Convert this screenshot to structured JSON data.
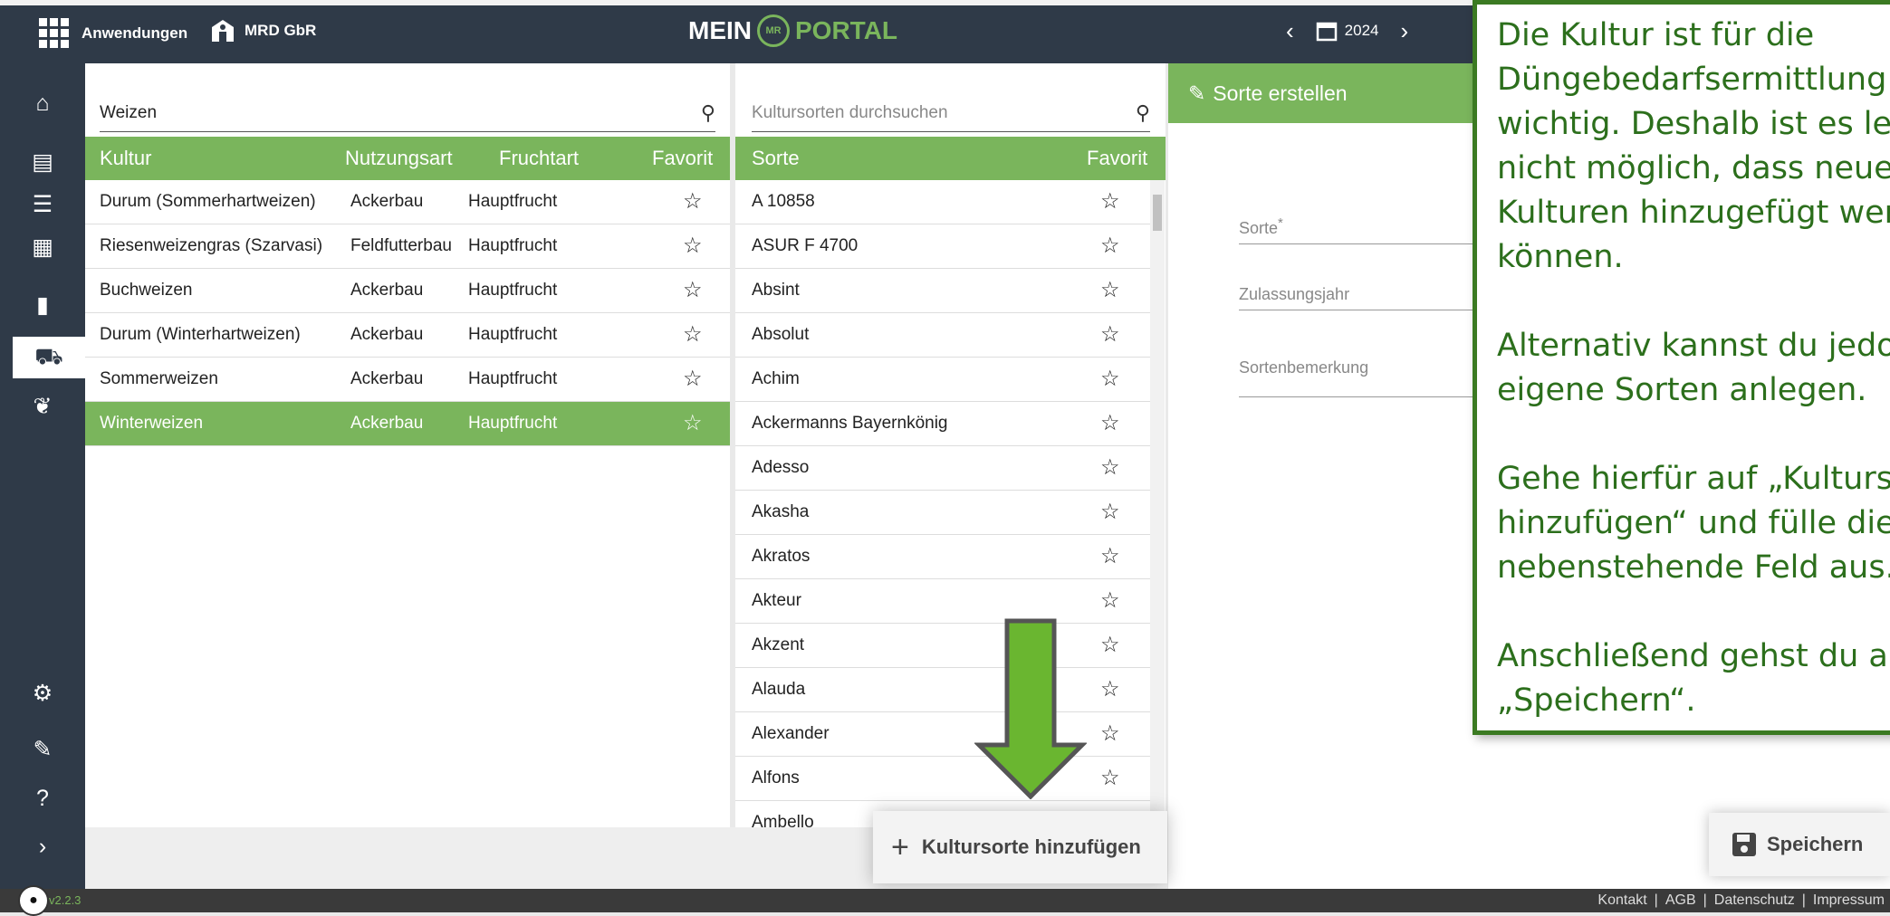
{
  "header": {
    "apps_label": "Anwendungen",
    "farm_name": "MRD GbR",
    "logo_left": "MEIN",
    "logo_seal": "MR",
    "logo_right": "PORTAL",
    "year": "2024"
  },
  "sidebar": {
    "items": [
      {
        "name": "home-icon",
        "glyph": "⌂"
      },
      {
        "name": "field-list-icon",
        "glyph": "▤"
      },
      {
        "name": "clipboard-icon",
        "glyph": "☰"
      },
      {
        "name": "calendar-icon",
        "glyph": "▦"
      },
      {
        "name": "bar-chart-icon",
        "glyph": "▮"
      },
      {
        "name": "tractor-icon",
        "glyph": "⛟"
      },
      {
        "name": "wheat-icon",
        "glyph": "❦"
      },
      {
        "name": "settings-icon",
        "glyph": "⚙"
      },
      {
        "name": "admin-icon",
        "glyph": "✎"
      },
      {
        "name": "help-icon",
        "glyph": "?"
      },
      {
        "name": "expand-icon",
        "glyph": "›"
      }
    ]
  },
  "cultures": {
    "search_value": "Weizen",
    "headers": {
      "kultur": "Kultur",
      "nutzungsart": "Nutzungsart",
      "fruchtart": "Fruchtart",
      "favorit": "Favorit"
    },
    "rows": [
      {
        "kultur": "Durum (Sommerhartweizen)",
        "nutzungsart": "Ackerbau",
        "fruchtart": "Hauptfrucht",
        "selected": false
      },
      {
        "kultur": "Riesenweizengras (Szarvasi)",
        "nutzungsart": "Feldfutterbau",
        "fruchtart": "Hauptfrucht",
        "selected": false
      },
      {
        "kultur": "Buchweizen",
        "nutzungsart": "Ackerbau",
        "fruchtart": "Hauptfrucht",
        "selected": false
      },
      {
        "kultur": "Durum (Winterhartweizen)",
        "nutzungsart": "Ackerbau",
        "fruchtart": "Hauptfrucht",
        "selected": false
      },
      {
        "kultur": "Sommerweizen",
        "nutzungsart": "Ackerbau",
        "fruchtart": "Hauptfrucht",
        "selected": false
      },
      {
        "kultur": "Winterweizen",
        "nutzungsart": "Ackerbau",
        "fruchtart": "Hauptfrucht",
        "selected": true
      }
    ]
  },
  "varieties": {
    "search_placeholder": "Kultursorten durchsuchen",
    "headers": {
      "sorte": "Sorte",
      "favorit": "Favorit"
    },
    "rows": [
      "A 10858",
      "ASUR F 4700",
      "Absint",
      "Absolut",
      "Achim",
      "Ackermanns Bayernkönig",
      "Adesso",
      "Akasha",
      "Akratos",
      "Akteur",
      "Akzent",
      "Alauda",
      "Alexander",
      "Alfons",
      "Ambello"
    ],
    "add_button": "Kultursorte hinzufügen"
  },
  "form": {
    "title": "Sorte erstellen",
    "field_sorte": "Sorte",
    "required_mark": "*",
    "field_jahr": "Zulassungsjahr",
    "field_bemerkung": "Sortenbemerkung",
    "save_button": "Speichern"
  },
  "tooltip": {
    "p1": "Die Kultur ist für die\nDüngebedarfsermittlung\nwichtig. Deshalb ist es leider\nnicht möglich, dass neue\nKulturen hinzugefügt werden\nkönnen.",
    "p2": "Alternativ kannst du jedoch\neigene Sorten anlegen.",
    "p3": "Gehe hierfür auf „Kultursorte\nhinzufügen“ und fülle die\nnebenstehende Feld aus.",
    "p4": "Anschließend gehst du auf\n„Speichern“."
  },
  "footer": {
    "version": "v2.2.3",
    "links": [
      "Kontakt",
      "AGB",
      "Datenschutz",
      "Impressum"
    ]
  },
  "colors": {
    "accent": "#7ab55c",
    "sidebar": "#2f3a48",
    "tooltip_border": "#3b7a22"
  }
}
